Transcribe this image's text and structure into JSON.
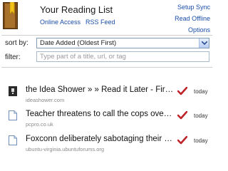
{
  "header": {
    "title": "Your Reading List",
    "online_access": "Online Access",
    "rss_feed": "RSS Feed",
    "setup_sync": "Setup Sync",
    "read_offline": "Read Offline",
    "options": "Options"
  },
  "sort": {
    "label": "sort by:",
    "selected": "Date Added (Oldest First)"
  },
  "filter": {
    "label": "filter:",
    "placeholder": "Type part of a title, url, or tag",
    "value": ""
  },
  "items": [
    {
      "title": "the Idea Shower » » Read it Later - Firefox Extension",
      "domain": "ideashower.com",
      "date": "today",
      "icon": "idea-shower-favicon"
    },
    {
      "title": "Teacher threatens to call the cops over laptop",
      "domain": "pcpro.co.uk",
      "date": "today",
      "icon": "page-icon"
    },
    {
      "title": "Foxconn deliberately sabotaging their motherboards",
      "domain": "ubuntu-virginia.ubuntuforums.org",
      "date": "today",
      "icon": "page-icon"
    }
  ],
  "colors": {
    "link": "#1a4ea8",
    "check": "#c0242b",
    "logo": "#8b5a1e"
  }
}
